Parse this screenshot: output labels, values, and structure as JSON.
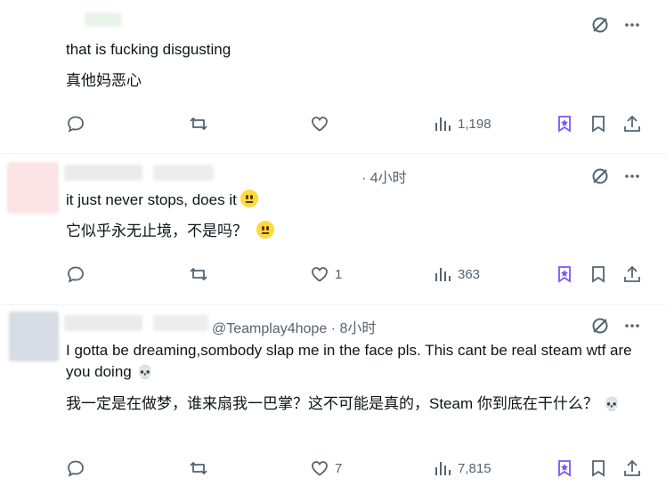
{
  "posts": [
    {
      "handle": "",
      "time": "",
      "text": "that is fucking disgusting",
      "translation": "真他妈恶心",
      "emoji": "",
      "actions": {
        "replies": "",
        "reposts": "",
        "likes": "",
        "views": "1,198"
      }
    },
    {
      "handle": "",
      "time": "· 4小时",
      "text": "it just never stops, does it",
      "translation": "它似乎永无止境，不是吗？",
      "emoji": "neutral-face",
      "actions": {
        "replies": "",
        "reposts": "",
        "likes": "1",
        "views": "363"
      }
    },
    {
      "handle": "@Teamplay4hope",
      "time": "· 8小时",
      "text": "I gotta be dreaming,sombody slap me in the face pls. This cant be real steam wtf are you doing",
      "translation": "我一定是在做梦，谁来扇我一巴掌？这不可能是真的，Steam 你到底在干什么？",
      "emoji": "skull",
      "actions": {
        "replies": "",
        "reposts": "",
        "likes": "7",
        "views": "7,815"
      }
    }
  ],
  "icons": {
    "grok": "grok-icon",
    "more": "more-icon",
    "reply": "reply-icon",
    "repost": "repost-icon",
    "like": "heart-icon",
    "views": "views-icon",
    "grok_action": "grok-action-icon",
    "bookmark": "bookmark-icon",
    "share": "share-icon"
  },
  "colors": {
    "text": "#0f1419",
    "secondary": "#536471",
    "accent": "#7856ff"
  }
}
